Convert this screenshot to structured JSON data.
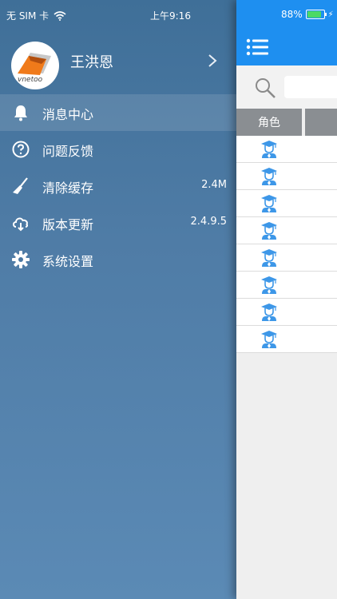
{
  "status_bar": {
    "carrier": "无 SIM 卡",
    "time": "上午9:16",
    "battery": "88%"
  },
  "profile": {
    "avatar_logo_text": "vnetoo",
    "name": "王洪恩"
  },
  "menu": {
    "items": [
      {
        "label": "消息中心",
        "icon": "bell-icon",
        "value": ""
      },
      {
        "label": "问题反馈",
        "icon": "question-circle-icon",
        "value": ""
      },
      {
        "label": "清除缓存",
        "icon": "broom-icon",
        "value": "2.4M"
      },
      {
        "label": "版本更新",
        "icon": "cloud-refresh-icon",
        "value": "2.4.9.5"
      },
      {
        "label": "系统设置",
        "icon": "gear-icon",
        "value": ""
      }
    ]
  },
  "main": {
    "column_headers": [
      "角色",
      ""
    ],
    "rows": [
      {
        "icon": "graduate-user-icon"
      },
      {
        "icon": "graduate-user-icon"
      },
      {
        "icon": "graduate-user-icon"
      },
      {
        "icon": "graduate-user-icon"
      },
      {
        "icon": "graduate-user-icon"
      },
      {
        "icon": "graduate-user-icon"
      },
      {
        "icon": "graduate-user-icon"
      },
      {
        "icon": "graduate-user-icon"
      }
    ]
  },
  "colors": {
    "header_blue": "#1e8ff0",
    "drawer_top": "#3f6f98",
    "drawer_bottom": "#5b8ab5",
    "icon_blue": "#3d97e8"
  }
}
